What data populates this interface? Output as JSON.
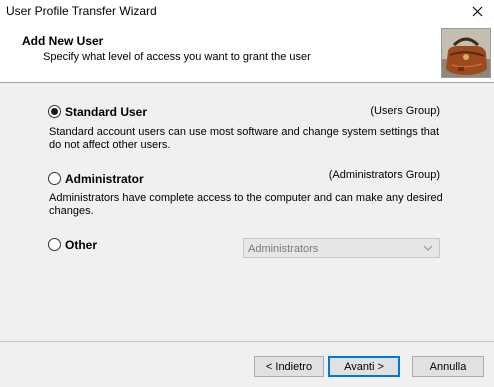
{
  "window": {
    "title": "User Profile Transfer Wizard",
    "close_icon": "close-icon"
  },
  "header": {
    "title": "Add New User",
    "subtitle": "Specify what level of access you want to grant the user",
    "image_icon": "leather-bag-image"
  },
  "options": [
    {
      "label": "Standard User",
      "group": "(Users Group)",
      "description": "Standard account users can use most software and change system settings that do not affect other users.",
      "selected": true
    },
    {
      "label": "Administrator",
      "group": "(Administrators Group)",
      "description": "Administrators have complete access to the computer and can make any desired changes.",
      "selected": false
    },
    {
      "label": "Other",
      "selected": false,
      "select_value": "Administrators",
      "select_enabled": false
    }
  ],
  "footer": {
    "back_label": "< Indietro",
    "next_label": "Avanti >",
    "cancel_label": "Annulla"
  }
}
